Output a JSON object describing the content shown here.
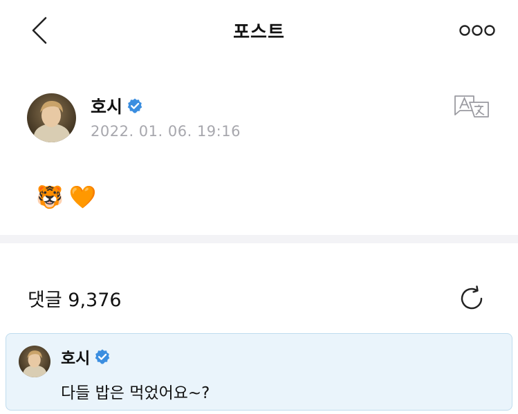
{
  "header": {
    "title": "포스트",
    "back_icon": "chevron-left-icon",
    "more_icon": "more-dots-icon"
  },
  "post": {
    "author": "호시",
    "verified_icon": "verified-badge-icon",
    "date": "2022. 01. 06. 19:16",
    "translate_icon": "translate-icon",
    "body_emojis": [
      "🐯",
      "🧡"
    ]
  },
  "comments": {
    "label": "댓글 9,376",
    "refresh_icon": "refresh-icon",
    "pinned": {
      "author": "호시",
      "text": "다들 밥은 먹었어요~?"
    }
  },
  "colors": {
    "accent_blue": "#3b8ee0",
    "date_gray": "#a7a7ad",
    "card_bg": "#eaf4fb",
    "card_border": "#bfdcee",
    "divider": "#f3f3f6"
  }
}
